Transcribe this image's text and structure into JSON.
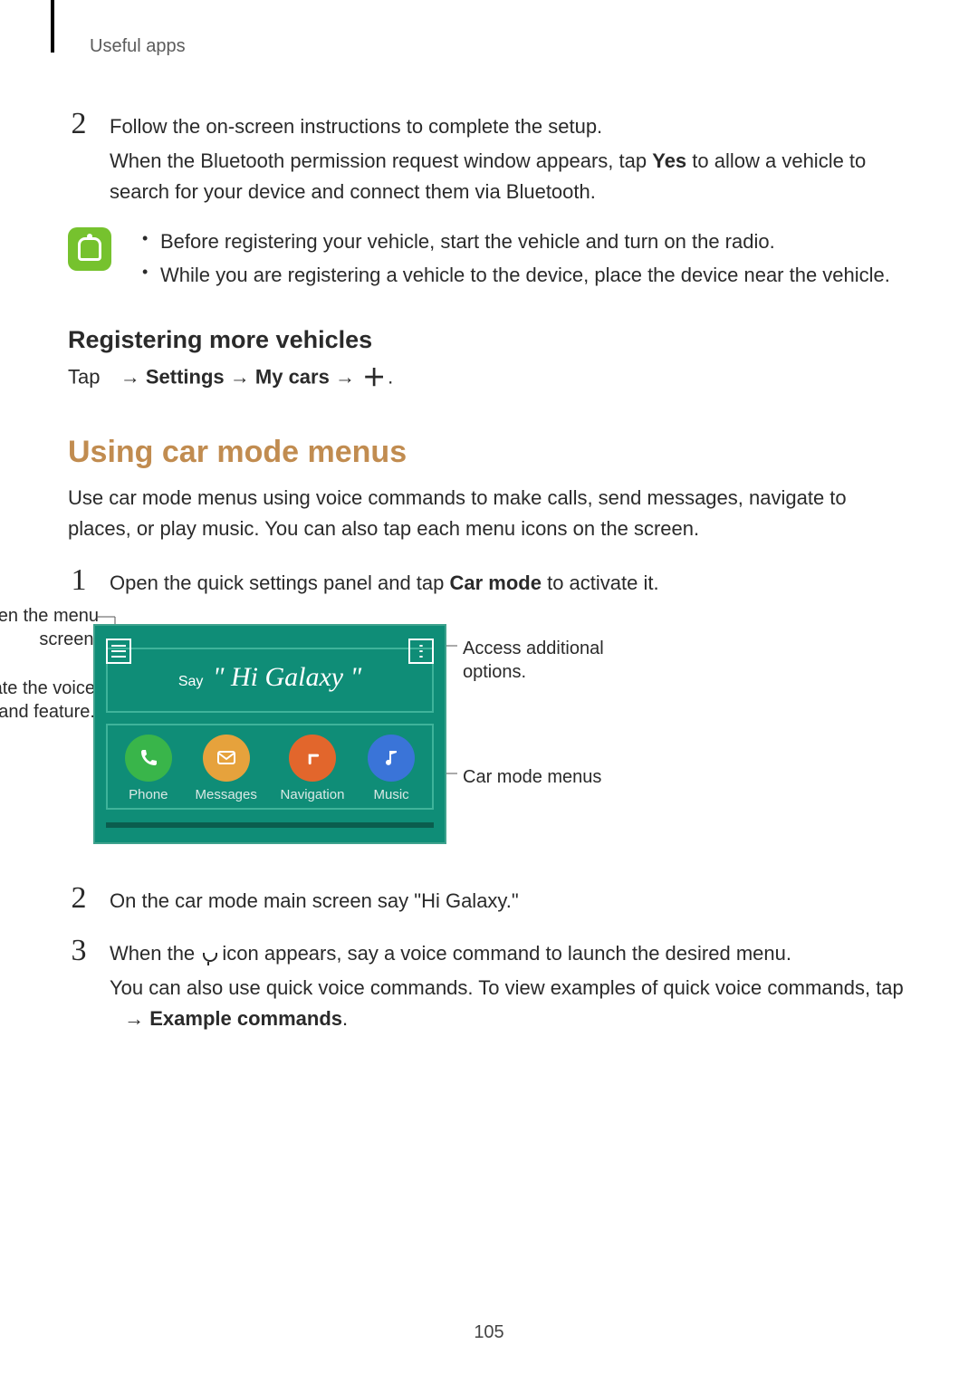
{
  "running_head": "Useful apps",
  "step2_line1": "Follow the on-screen instructions to complete the setup.",
  "step2_line2_pre": "When the Bluetooth permission request window appears, tap ",
  "step2_yes": "Yes",
  "step2_line2_post": " to allow a vehicle to search for your device and connect them via Bluetooth.",
  "note_bullets": [
    "Before registering your vehicle, start the vehicle and turn on the radio.",
    "While you are registering a vehicle to the device, place the device near the vehicle."
  ],
  "h3_register": "Registering more vehicles",
  "tap_label": "Tap ",
  "arrow": " → ",
  "settings": "Settings",
  "mycars": "My cars",
  "period": ".",
  "h2_using": "Using car mode menus",
  "using_para": "Use car mode menus using voice commands to make calls, send messages, navigate to places, or play music. You can also tap each menu icons on the screen.",
  "s1_pre": "Open the quick settings panel and tap ",
  "s1_carmode": "Car mode",
  "s1_post": " to activate it.",
  "s2_text": "On the car mode main screen say \"Hi Galaxy.\"",
  "s3_pre": "When the ",
  "s3_post": " icon appears, say a voice command to launch the desired menu.",
  "s3_para2_pre": "You can also use quick voice commands. To view examples of quick voice commands, tap ",
  "s3_example": "Example commands",
  "callouts": {
    "open_menu": "Open the menu screen.",
    "activate_voice": "Activate the voice command feature.",
    "access_options": "Access additional options.",
    "carmode_menus": "Car mode menus"
  },
  "screen": {
    "say_label": "Say",
    "say_phrase": "\" Hi Galaxy \"",
    "items": [
      "Phone",
      "Messages",
      "Navigation",
      "Music"
    ]
  },
  "page_number": "105",
  "nums": {
    "two_a": "2",
    "one": "1",
    "two_b": "2",
    "three": "3"
  }
}
